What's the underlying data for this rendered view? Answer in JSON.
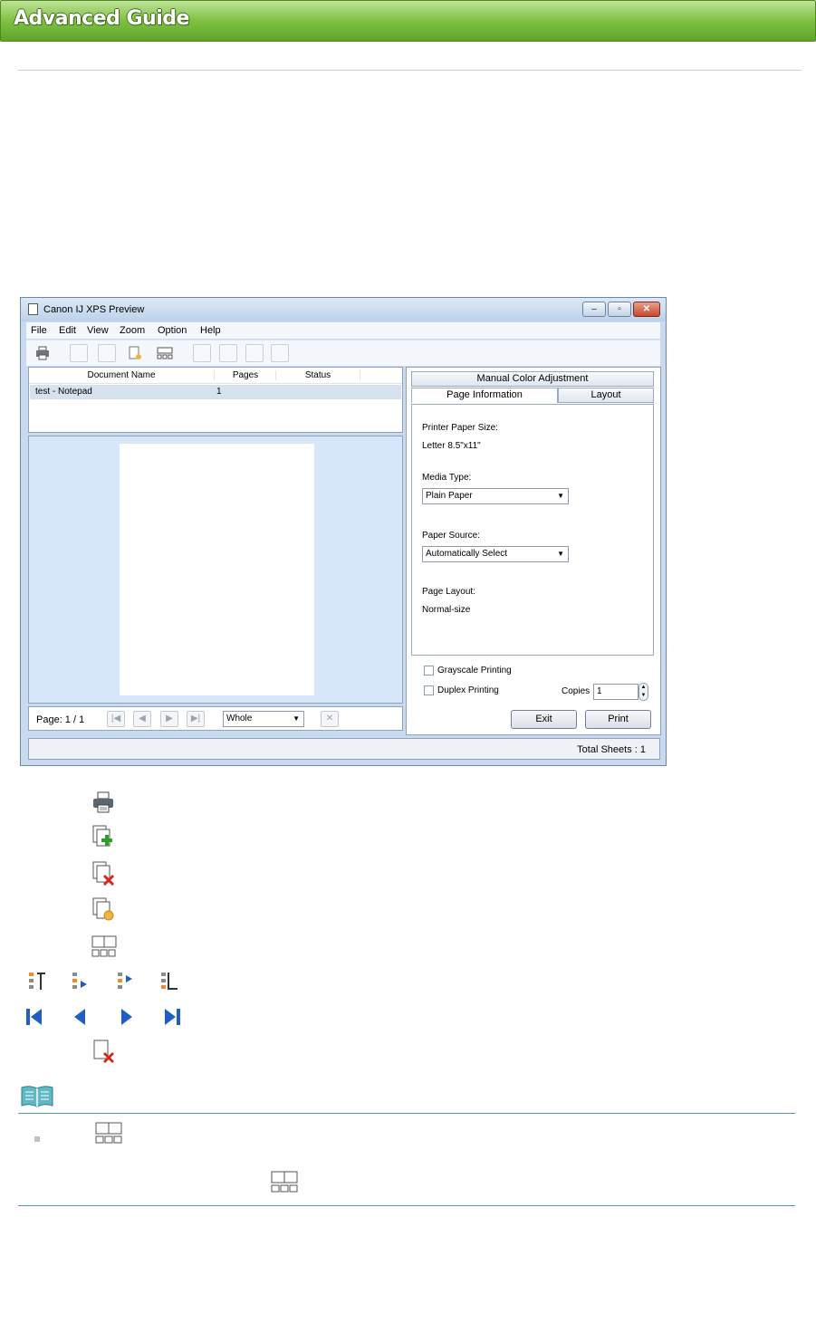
{
  "header": {
    "title": "Advanced Guide"
  },
  "window": {
    "title": "Canon IJ XPS Preview",
    "menu": [
      "File",
      "Edit",
      "View",
      "Zoom",
      "Option",
      "Help"
    ],
    "doc_columns": [
      "Document Name",
      "Pages",
      "Status"
    ],
    "doc_row": {
      "name": "test - Notepad",
      "pages": "1",
      "status": ""
    },
    "page_indicator": "Page: 1 / 1",
    "zoom_value": "Whole",
    "tabs": {
      "top": "Manual Color Adjustment",
      "left": "Page Information",
      "right": "Layout"
    },
    "printer_paper_size_label": "Printer Paper Size:",
    "printer_paper_size_value": "Letter 8.5\"x11\"",
    "media_type_label": "Media Type:",
    "media_type_value": "Plain Paper",
    "paper_source_label": "Paper Source:",
    "paper_source_value": "Automatically Select",
    "page_layout_label": "Page Layout:",
    "page_layout_value": "Normal-size",
    "grayscale_label": "Grayscale Printing",
    "duplex_label": "Duplex Printing",
    "copies_label": "Copies",
    "copies_value": "1",
    "exit_label": "Exit",
    "print_label": "Print",
    "total_sheets": "Total Sheets :  1"
  },
  "icons": {
    "legend": [
      "print-icon",
      "add-document-icon",
      "delete-document-icon",
      "reset-settings-icon",
      "thumbnail-view-icon",
      "move-top-icon",
      "move-up-icon",
      "move-down-icon",
      "move-bottom-icon",
      "first-page-icon",
      "previous-page-icon",
      "next-page-icon",
      "last-page-icon",
      "delete-page-icon",
      "note-icon"
    ],
    "accent_blue": "#1f5fc4",
    "accent_red": "#d22a1e",
    "accent_orange": "#f28c28"
  }
}
